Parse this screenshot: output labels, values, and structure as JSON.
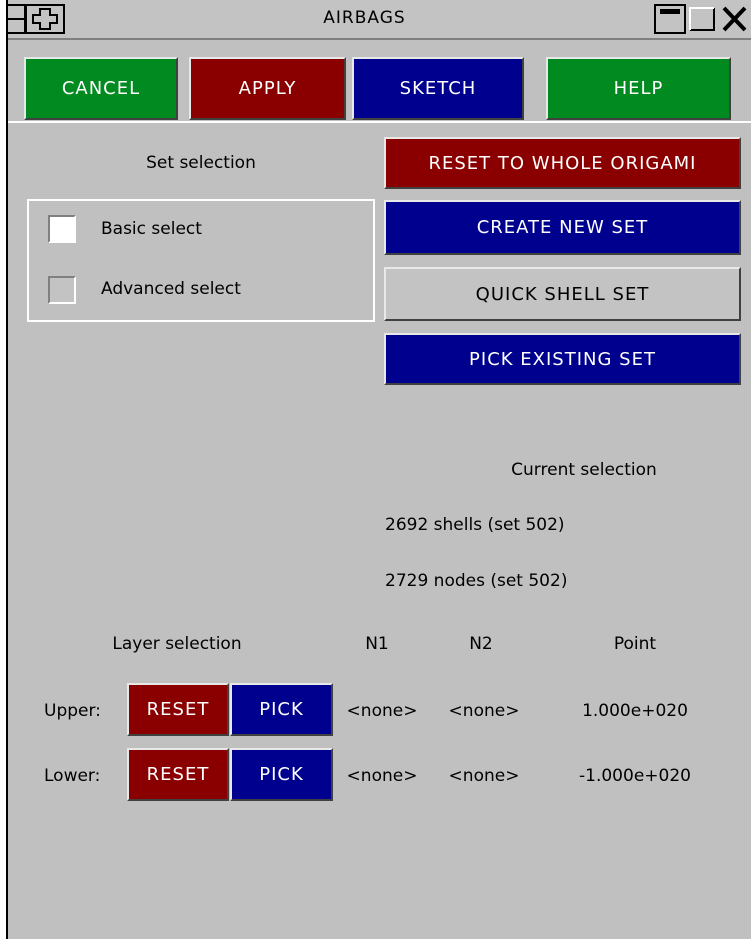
{
  "window": {
    "title": "AIRBAGS"
  },
  "toolbar": {
    "cancel_label": "CANCEL",
    "apply_label": "APPLY",
    "sketch_label": "SKETCH",
    "help_label": "HELP"
  },
  "set_selection": {
    "heading": "Set selection",
    "basic_label": "Basic select",
    "basic_checked": true,
    "advanced_label": "Advanced select",
    "advanced_checked": false
  },
  "actions": {
    "reset_whole_label": "RESET TO WHOLE ORIGAMI",
    "create_new_label": "CREATE NEW SET",
    "quick_shell_label": "QUICK SHELL SET",
    "pick_existing_label": "PICK EXISTING SET"
  },
  "current_selection": {
    "heading": "Current selection",
    "shells": "2692 shells (set 502)",
    "nodes": "2729 nodes (set 502)"
  },
  "layer_selection": {
    "heading": "Layer selection",
    "col_n1": "N1",
    "col_n2": "N2",
    "col_point": "Point",
    "rows": [
      {
        "label": "Upper:",
        "reset_label": "RESET",
        "pick_label": "PICK",
        "n1": "<none>",
        "n2": "<none>",
        "point": "1.000e+020"
      },
      {
        "label": "Lower:",
        "reset_label": "RESET",
        "pick_label": "PICK",
        "n1": "<none>",
        "n2": "<none>",
        "point": "-1.000e+020"
      }
    ]
  },
  "colors": {
    "green": "#008a1f",
    "red": "#8a0000",
    "blue": "#00008f",
    "panel": "#c0c0c0"
  }
}
